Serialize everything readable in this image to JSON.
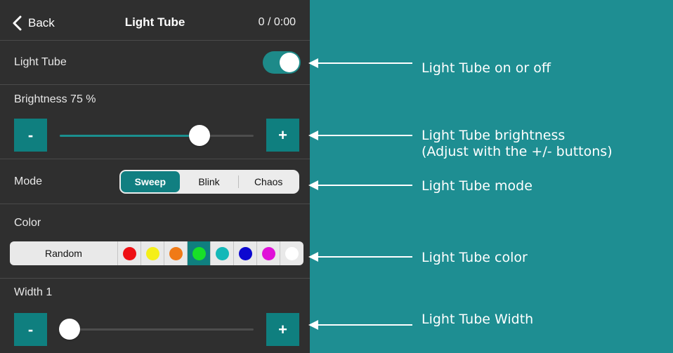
{
  "header": {
    "back_label": "Back",
    "title": "Light Tube",
    "time": "0 / 0:00"
  },
  "light_tube": {
    "label": "Light Tube",
    "on": true
  },
  "brightness": {
    "label": "Brightness 75 %",
    "value_fraction": 0.72,
    "minus": "-",
    "plus": "+"
  },
  "mode": {
    "label": "Mode",
    "options": [
      "Sweep",
      "Blink",
      "Chaos"
    ],
    "selected": "Sweep"
  },
  "color": {
    "label": "Color",
    "random_label": "Random",
    "swatches": [
      "#ee0f14",
      "#f5ef18",
      "#f07a16",
      "#18e028",
      "#14b8b8",
      "#0c08d0",
      "#e010d8",
      "#ffffff"
    ],
    "selected_index": 3
  },
  "width": {
    "label": "Width 1",
    "value_fraction": 0.05,
    "minus": "-",
    "plus": "+"
  },
  "annotations": {
    "onoff": "Light Tube on or off",
    "brightness_line1": "Light Tube brightness",
    "brightness_line2": "(Adjust with the +/- buttons)",
    "mode": "Light Tube mode",
    "color": "Light Tube color",
    "width": "Light Tube Width"
  },
  "colors": {
    "teal_background": "#1e8e92",
    "panel": "#2f2f2f",
    "accent": "#0f7f7f"
  }
}
